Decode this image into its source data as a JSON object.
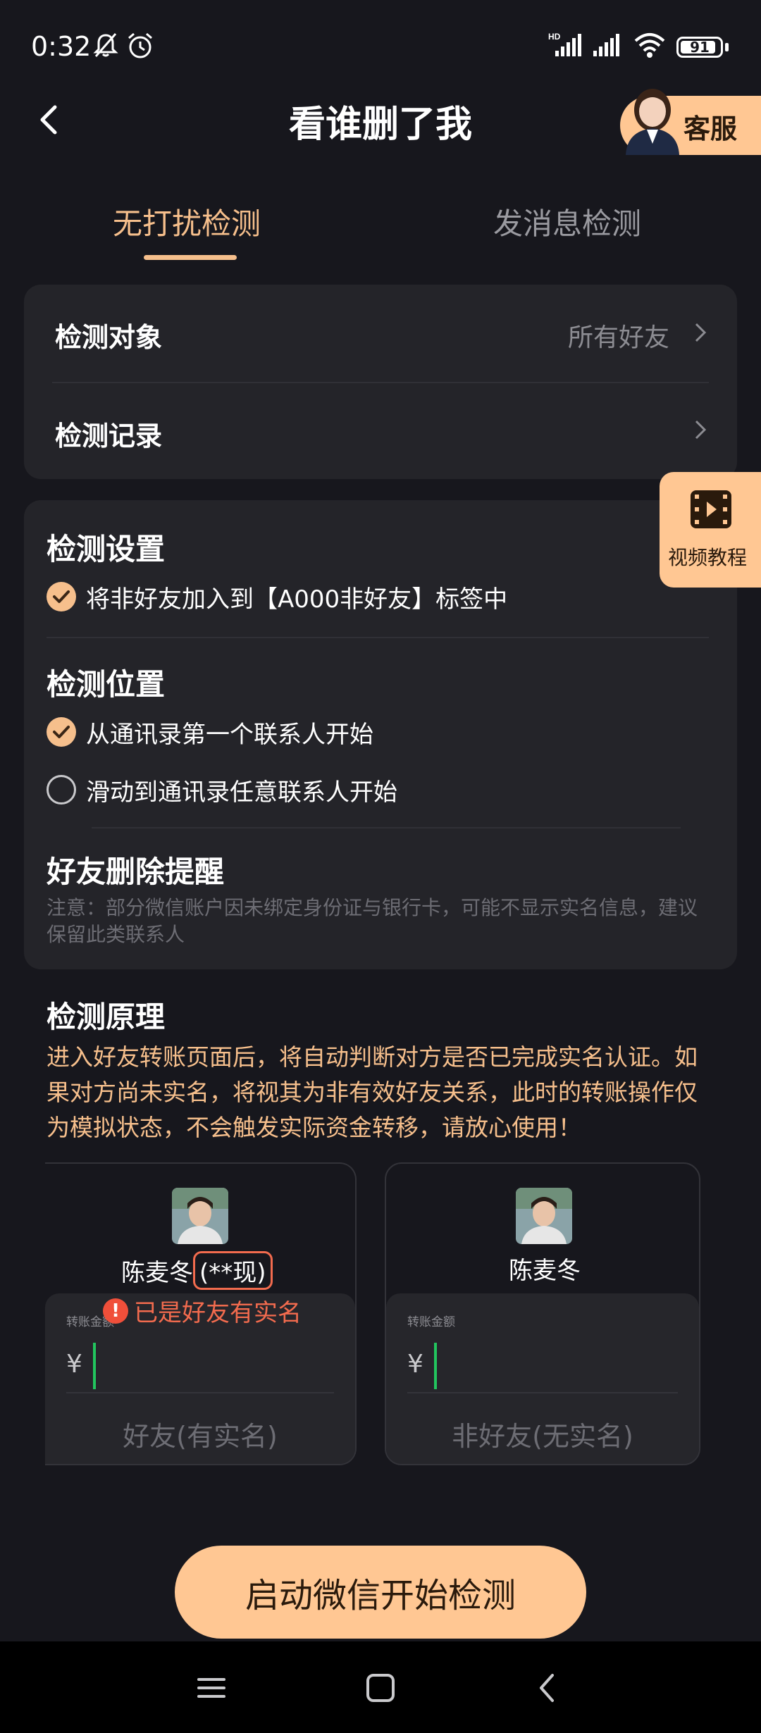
{
  "status_bar": {
    "time": "0:32",
    "battery": "91",
    "battery_level": 0.91
  },
  "header": {
    "title": "看谁删了我",
    "service_label": "客服"
  },
  "tabs": [
    {
      "label": "无打扰检测",
      "active": true
    },
    {
      "label": "发消息检测",
      "active": false
    }
  ],
  "target_card": {
    "target_label": "检测对象",
    "target_value": "所有好友",
    "record_label": "检测记录"
  },
  "settings": {
    "title": "检测设置",
    "option_label": "将非好友加入到【A000非好友】标签中",
    "option_checked": true
  },
  "position": {
    "title": "检测位置",
    "options": [
      {
        "label": "从通讯录第一个联系人开始",
        "checked": true
      },
      {
        "label": "滑动到通讯录任意联系人开始",
        "checked": false
      }
    ]
  },
  "reminder": {
    "title": "好友删除提醒",
    "note": "注意：部分微信账户因未绑定身份证与银行卡，可能不显示实名信息，建议保留此类联系人"
  },
  "video_tutorial": {
    "label": "视频教程"
  },
  "principle": {
    "title": "检测原理",
    "text": "进入好友转账页面后，将自动判断对方是否已完成实名认证。如果对方尚未实名，将视其为非有效好友关系，此时的转账操作仅为模拟状态，不会触发实际资金转移，请放心使用！"
  },
  "demo": [
    {
      "name": "陈麦冬",
      "realname": "(**现)",
      "pay_label": "转账金额",
      "currency": "¥",
      "warning": "已是好友有实名",
      "caption": "好友(有实名)"
    },
    {
      "name": "陈麦冬",
      "pay_label": "转账金额",
      "currency": "¥",
      "caption": "非好友(无实名)"
    }
  ],
  "start_button": {
    "label": "启动微信开始检测"
  },
  "colors": {
    "accent": "#f6bf8c",
    "accent_fill": "#ffc793",
    "warning": "#f26b4e",
    "background": "#17171d",
    "card": "#242429"
  }
}
